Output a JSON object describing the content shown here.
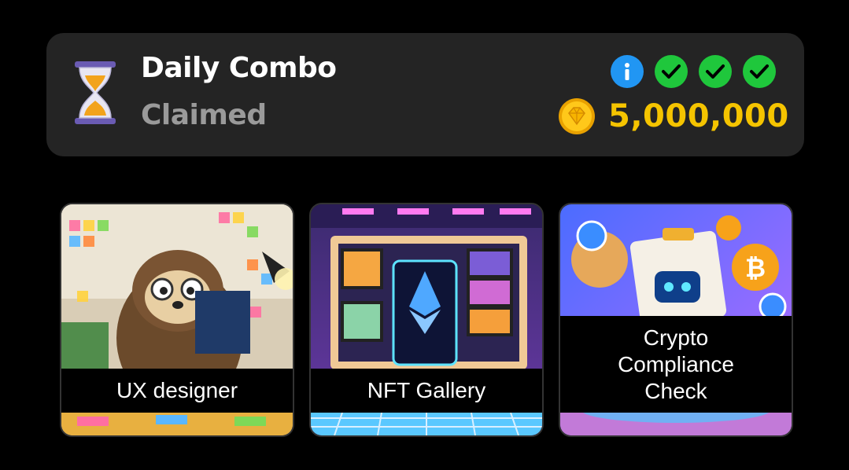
{
  "daily_combo": {
    "title": "Daily Combo",
    "status": "Claimed",
    "reward": "5,000,000",
    "icons": {
      "hourglass": "hourglass-icon",
      "info": "info-icon",
      "check": "check-icon",
      "coin": "coin-icon"
    },
    "colors": {
      "card_bg": "#242424",
      "reward_text": "#f5c400",
      "info_badge": "#2196f3",
      "check_badge": "#1fc73c"
    }
  },
  "cards": [
    {
      "label": "UX designer"
    },
    {
      "label": "NFT Gallery"
    },
    {
      "label": "Crypto\nCompliance\nCheck"
    }
  ]
}
